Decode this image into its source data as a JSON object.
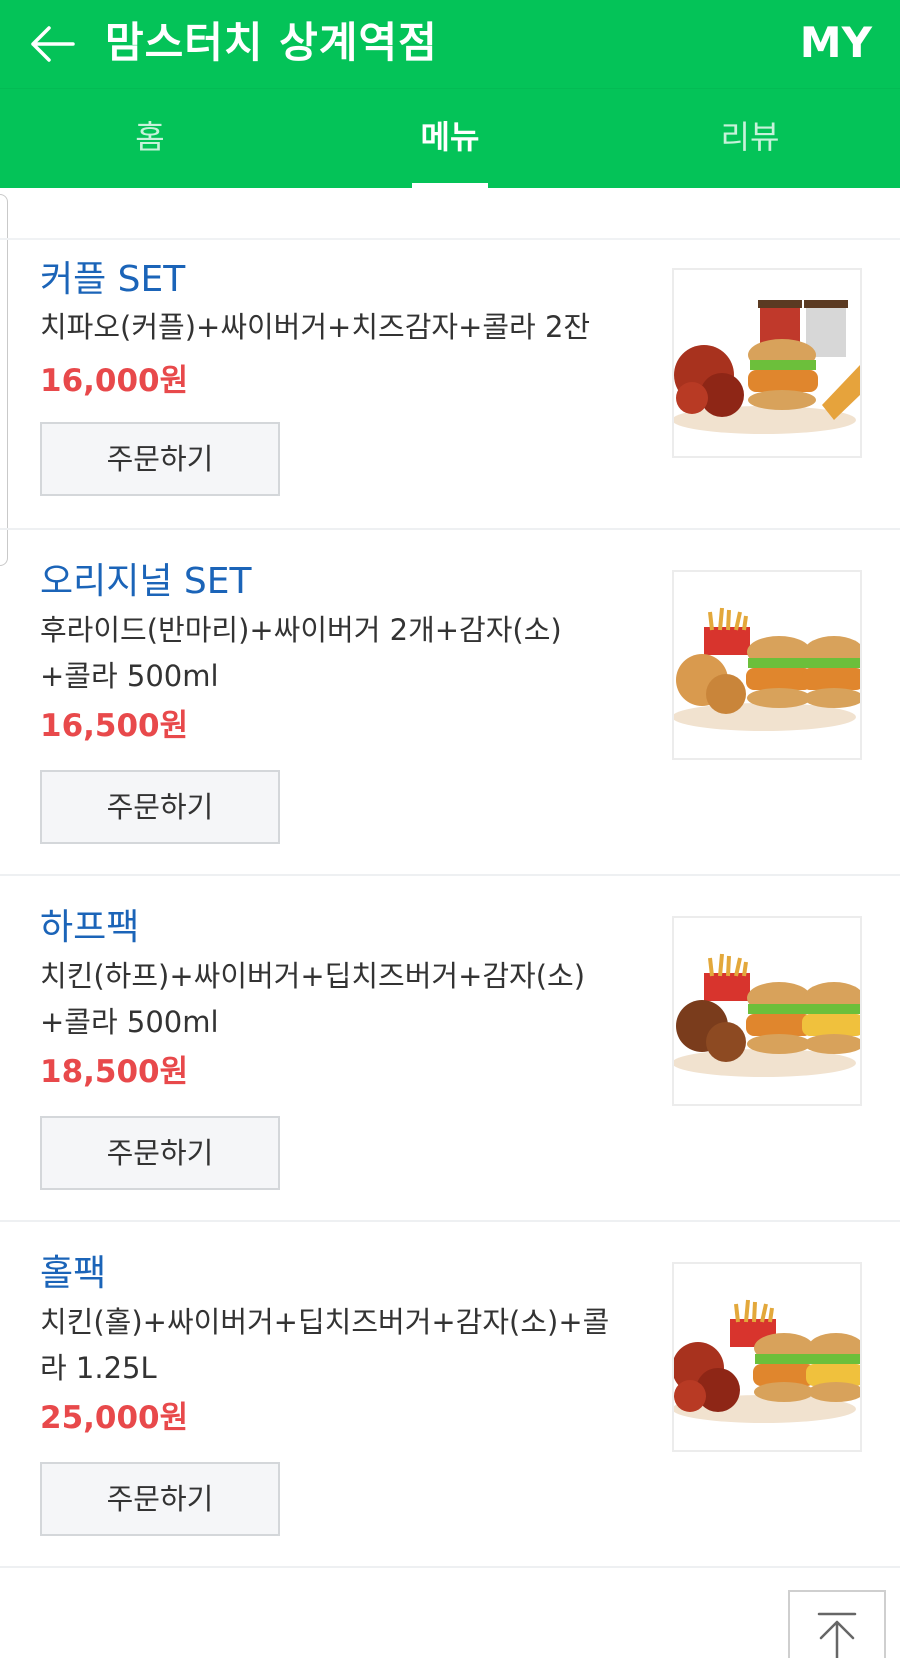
{
  "header": {
    "title": "맘스터치 상계역점",
    "my_label": "MY",
    "bg_color": "#04c358"
  },
  "tabs": [
    {
      "label": "홈",
      "active": false
    },
    {
      "label": "메뉴",
      "active": true
    },
    {
      "label": "리뷰",
      "active": false
    }
  ],
  "menu_items": [
    {
      "name": "커플 SET",
      "description": "치파오(커플)+싸이버거+치즈감자+콜라 2잔",
      "price": "16,000원",
      "order_label": "주문하기",
      "image_icon": "couple-set-food-photo"
    },
    {
      "name": "오리지널 SET",
      "description": "후라이드(반마리)+싸이버거 2개+감자(소)\n+콜라 500ml",
      "price": "16,500원",
      "order_label": "주문하기",
      "image_icon": "original-set-food-photo"
    },
    {
      "name": "하프팩",
      "description": "치킨(하프)+싸이버거+딥치즈버거+감자(소)\n+콜라 500ml",
      "price": "18,500원",
      "order_label": "주문하기",
      "image_icon": "half-pack-food-photo"
    },
    {
      "name": "홀팩",
      "description": "치킨(홀)+싸이버거+딥치즈버거+감자(소)+콜\n라 1.25L",
      "price": "25,000원",
      "order_label": "주문하기",
      "image_icon": "whole-pack-food-photo"
    }
  ],
  "colors": {
    "name": "#1b64b8",
    "price": "#e8494b"
  }
}
